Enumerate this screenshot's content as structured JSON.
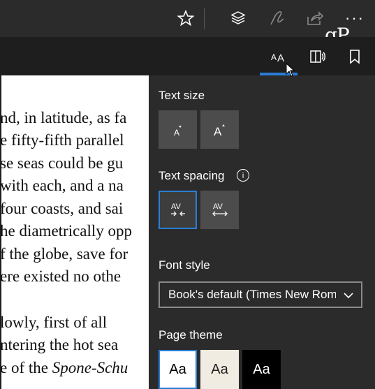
{
  "toolbar": {
    "favorites_icon": "star-icon",
    "hub_icon": "layers-icon",
    "notes_icon": "pen-icon",
    "share_icon": "share-icon",
    "more_label": "···"
  },
  "reading_toolbar": {
    "text_options_label": "AA",
    "read_aloud_icon": "read-aloud-icon",
    "bookmark_icon": "bookmark-icon"
  },
  "watermark": "gP",
  "reader": {
    "lines": [
      "nd, in latitude, as fa",
      "e fifty-fifth parallel",
      "se seas could be gu",
      "with each, and a na",
      "four coasts, and sai",
      "he diametrically opp",
      "f the globe, save for",
      "ere existed no othe",
      "",
      "lowly, first of all",
      "ntering the hot sea",
      "e of the Spone-Schu"
    ]
  },
  "panel": {
    "text_size": {
      "title": "Text size",
      "decrease_label": "A",
      "increase_label": "A"
    },
    "text_spacing": {
      "title": "Text spacing",
      "info_label": "i",
      "narrow_label": "AV",
      "wide_label": "AV"
    },
    "font_style": {
      "title": "Font style",
      "selected": "Book's default (Times New Roman)"
    },
    "page_theme": {
      "title": "Page theme",
      "themes": [
        {
          "label": "Aa",
          "bg": "#ffffff",
          "fg": "#000000"
        },
        {
          "label": "Aa",
          "bg": "#f1ece1",
          "fg": "#222222"
        },
        {
          "label": "Aa",
          "bg": "#000000",
          "fg": "#ffffff"
        }
      ]
    }
  },
  "colors": {
    "accent": "#2a7dd6",
    "panel_bg": "#2b2b2b",
    "button_bg": "#4c4c4c"
  }
}
